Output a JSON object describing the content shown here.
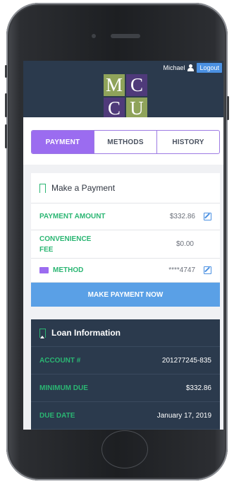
{
  "header": {
    "user_name": "Michael",
    "logout_label": "Logout",
    "logo_letters": [
      "M",
      "C",
      "C",
      "U"
    ]
  },
  "tabs": [
    {
      "label": "PAYMENT",
      "active": true
    },
    {
      "label": "METHODS",
      "active": false
    },
    {
      "label": "HISTORY",
      "active": false
    }
  ],
  "payment_card": {
    "title": "Make a Payment",
    "rows": [
      {
        "label": "PAYMENT AMOUNT",
        "value": "$332.86",
        "editable": true
      },
      {
        "label": "CONVENIENCE FEE",
        "value": "$0.00",
        "editable": false
      },
      {
        "label": "METHOD",
        "value": "****4747",
        "editable": true
      }
    ],
    "button_label": "MAKE PAYMENT NOW"
  },
  "loan_card": {
    "title": "Loan Information",
    "rows": [
      {
        "label": "ACCOUNT #",
        "value": "201277245-835"
      },
      {
        "label": "MINIMUM DUE",
        "value": "$332.86"
      },
      {
        "label": "DUE DATE",
        "value": "January 17, 2019"
      }
    ]
  },
  "colors": {
    "accent_purple": "#9b6cf0",
    "accent_green": "#2bb673",
    "primary_blue": "#5aa0e6",
    "dark_navy": "#2b3a4d"
  }
}
